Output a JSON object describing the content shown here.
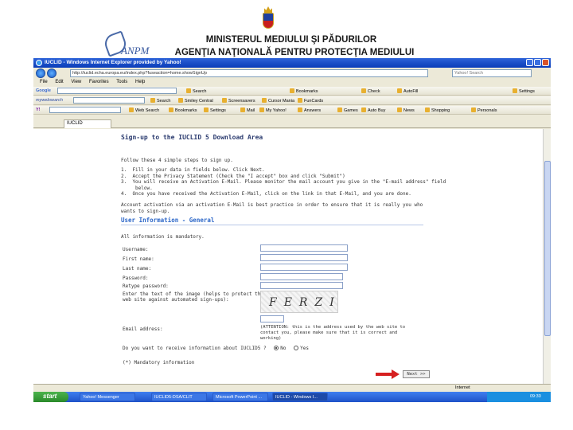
{
  "slide": {
    "title_line1": "MINISTERUL MEDIULUI ŞI PĂDURILOR",
    "title_line2": "AGENŢIA NAŢIONALĂ PENTRU PROTECŢIA MEDIULUI",
    "logo_text": "ANPM"
  },
  "browser": {
    "window_title": "IUCLID - Windows Internet Explorer provided by Yahoo!",
    "address": "http://iuclid.echa.europa.eu/index.php?fuseaction=home.showSignUp",
    "search_placeholder": "Yahoo! Search",
    "menu": [
      "File",
      "Edit",
      "View",
      "Favorites",
      "Tools",
      "Help"
    ],
    "google_label": "Google",
    "google_items": [
      "Search",
      "Bookmarks",
      "Check",
      "AutoFill",
      "Settings"
    ],
    "mywebsearch_label": "mywebsearch",
    "mywebsearch_items": [
      "Search",
      "Smiley Central",
      "Screensavers",
      "Cursor Mania",
      "FunCards"
    ],
    "yahoo_items": [
      "Web Search",
      "Bookmarks",
      "Settings",
      "Mail",
      "My Yahoo!",
      "Answers",
      "Games",
      "Auto Buy",
      "News",
      "Shopping",
      "Personals"
    ],
    "tab_label": "IUCLID",
    "status_zone": "Internet"
  },
  "form": {
    "heading": "Sign-up to the IUCLID 5 Download Area",
    "intro": "Follow these 4 simple steps to sign up.",
    "steps": "1.  Fill in your data in fields below. Click Next.\n2.  Accept the Privacy Statement (Check the \"I accept\" box and click \"Submit\")\n3.  You will receive an Activation E-Mail. Please monitor the mail account you give in the \"E-mail address\" field\n     below.\n4.  Once you have received the Activation E-Mail, click on the link in that E-Mail, and you are done.",
    "note": "Account activation via an activation E-Mail is best practice in order to ensure that it is really you who wants to sign-up.",
    "section_title": "User Information - General",
    "mandatory_note": "All information is mandatory.",
    "fields": {
      "username": "Username:",
      "first_name": "First name:",
      "last_name": "Last name:",
      "password": "Password:",
      "retype_password": "Retype password:",
      "captcha_prompt_1": "Enter the text of the image (helps to protect the",
      "captcha_prompt_2": "web site against automated sign-ups):",
      "email": "Email address:"
    },
    "captcha_text": "FERZI",
    "attention": "(ATTENTION: this is the address used by the web site to contact you, please make sure that it is correct and working)",
    "newsletter_question": "Do you want to receive information about IUCLID5 ?",
    "radio_no": "No",
    "radio_yes": "Yes",
    "footnote": "(*) Mandatory information",
    "next_button": "Next >>"
  },
  "taskbar": {
    "start_label": "start",
    "tasks": [
      "Yahoo! Messenger",
      "IUCLID5-DSA/CLIT",
      "Microsoft PowerPoint ...",
      "IUCLID - Windows I..."
    ],
    "clock": "09:30"
  },
  "colors": {
    "heading": "#2c3c70",
    "section": "#2b66c8",
    "arrow": "#d62020",
    "titlebar": "#0a3cb8"
  }
}
